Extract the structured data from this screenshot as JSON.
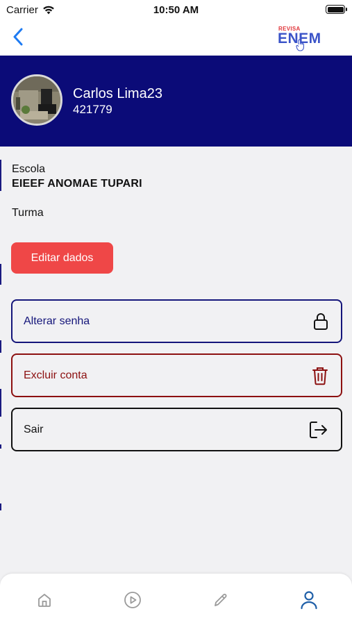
{
  "status_bar": {
    "carrier": "Carrier",
    "time": "10:50 AM"
  },
  "nav": {
    "back_icon": "chevron-left-icon",
    "logo": {
      "top": "REVISA",
      "main": "ENEM"
    }
  },
  "profile": {
    "name": "Carlos Lima23",
    "id": "421779"
  },
  "info": {
    "school_label": "Escola",
    "school_value": "EIEEF ANOMAE TUPARI",
    "class_label": "Turma",
    "class_value": ""
  },
  "edit_button": {
    "label": "Editar dados"
  },
  "actions": [
    {
      "label": "Alterar senha",
      "icon": "lock-icon",
      "color": "#14157a"
    },
    {
      "label": "Excluir conta",
      "icon": "trash-icon",
      "color": "#8c1010"
    },
    {
      "label": "Sair",
      "icon": "logout-icon",
      "color": "#111111"
    }
  ],
  "tab_bar": {
    "items": [
      {
        "icon": "home-icon",
        "active": false
      },
      {
        "icon": "play-icon",
        "active": false
      },
      {
        "icon": "pencil-icon",
        "active": false
      },
      {
        "icon": "user-icon",
        "active": true
      }
    ],
    "active_color": "#1f5fa8",
    "inactive_color": "#9a9a9a"
  },
  "colors": {
    "header_bg": "#0b0b78",
    "edit_button_bg": "#ef4747",
    "background": "#f1f1f3"
  }
}
